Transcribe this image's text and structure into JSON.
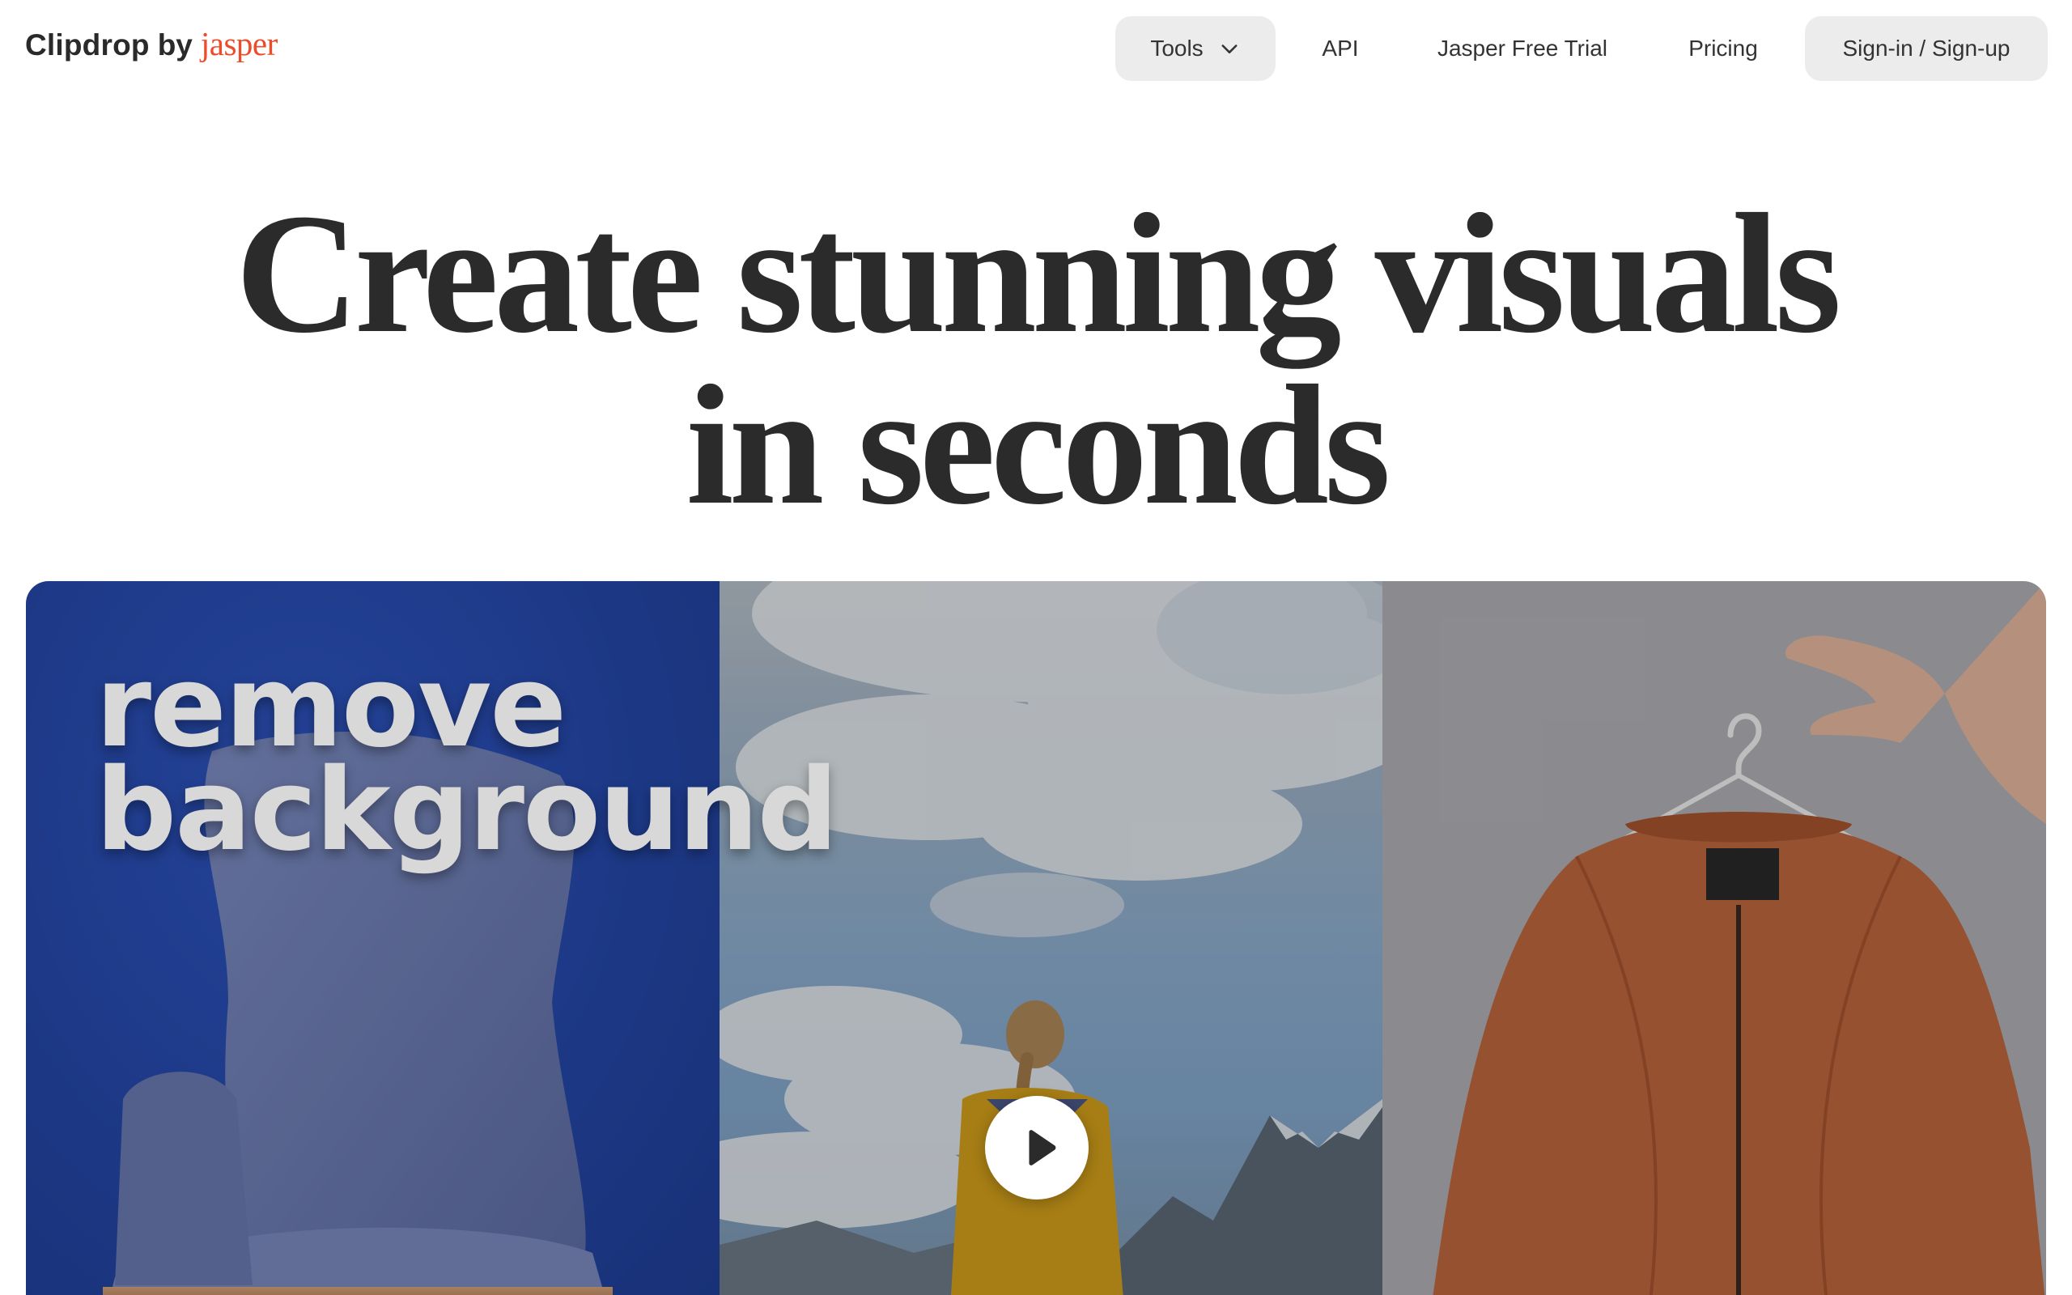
{
  "header": {
    "logo": {
      "name": "Clipdrop",
      "by": "by",
      "brand": "jasper",
      "brand_color": "#ee4b2b"
    },
    "nav": {
      "tools_label": "Tools",
      "api_label": "API",
      "trial_label": "Jasper Free Trial",
      "pricing_label": "Pricing",
      "signin_label": "Sign-in / Sign-up"
    }
  },
  "hero": {
    "title_line1": "Create stunning visuals",
    "title_line2": "in seconds"
  },
  "showcase": {
    "caption_line1": "remove",
    "caption_line2": "background",
    "play_icon": "play-icon",
    "colors": {
      "left_panel": "#274bb0",
      "right_panel": "#b3b3b8"
    }
  }
}
